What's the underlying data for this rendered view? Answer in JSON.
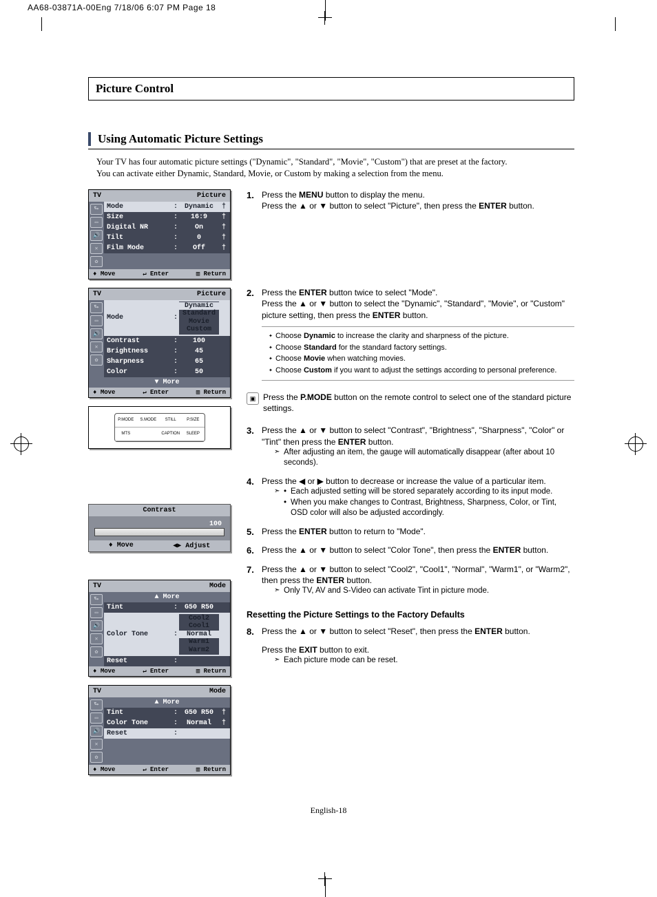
{
  "print_header": "AA68-03871A-00Eng  7/18/06  6:07 PM  Page 18",
  "section_title": "Picture Control",
  "subheading": "Using Automatic Picture Settings",
  "intro_line1": "Your TV has four automatic picture settings (\"Dynamic\", \"Standard\", \"Movie\", \"Custom\") that are preset at the factory.",
  "intro_line2": "You can activate either Dynamic, Standard, Movie, or Custom by making a selection from the menu.",
  "osd1": {
    "title_left": "TV",
    "title_right": "Picture",
    "rows": [
      {
        "label": "Mode",
        "value": "Dynamic",
        "hl": true,
        "arrow": "†"
      },
      {
        "label": "Size",
        "value": "16:9",
        "arrow": "†"
      },
      {
        "label": "Digital NR",
        "value": "On",
        "arrow": "†"
      },
      {
        "label": "Tilt",
        "value": "0",
        "arrow": "†"
      },
      {
        "label": "Film Mode",
        "value": "Off",
        "arrow": "†"
      }
    ],
    "footer": {
      "move": "Move",
      "enter": "Enter",
      "return": "Return"
    }
  },
  "osd2": {
    "title_left": "TV",
    "title_right": "Picture",
    "mode_label": "Mode",
    "options": [
      "Dynamic",
      "Standard",
      "Movie",
      "Custom"
    ],
    "option_hl": "Dynamic",
    "rows": [
      {
        "label": "Contrast",
        "value": "100"
      },
      {
        "label": "Brightness",
        "value": "45"
      },
      {
        "label": "Sharpness",
        "value": "65"
      },
      {
        "label": "Color",
        "value": "50"
      }
    ],
    "more": "▼ More",
    "footer": {
      "move": "Move",
      "enter": "Enter",
      "return": "Return"
    }
  },
  "remote": {
    "btns": [
      "P.MODE",
      "S.MODE",
      "STILL",
      "P.SIZE",
      "MTS",
      "",
      "CAPTION",
      "SLEEP"
    ]
  },
  "contrast": {
    "title": "Contrast",
    "value": "100",
    "move": "Move",
    "adjust": "Adjust"
  },
  "osd3": {
    "title_left": "TV",
    "title_right": "Mode",
    "more_top": "▲ More",
    "rows": [
      {
        "label": "Tint",
        "value": "G50 R50"
      },
      {
        "label": "Color Tone",
        "value": ""
      },
      {
        "label": "Reset",
        "value": ""
      }
    ],
    "options": [
      "Cool2",
      "Cool1",
      "Normal",
      "Warm1",
      "Warm2"
    ],
    "option_hl": "Normal",
    "footer": {
      "move": "Move",
      "enter": "Enter",
      "return": "Return"
    }
  },
  "osd4": {
    "title_left": "TV",
    "title_right": "Mode",
    "more_top": "▲ More",
    "rows": [
      {
        "label": "Tint",
        "value": "G50 R50",
        "arrow": "†"
      },
      {
        "label": "Color Tone",
        "value": "Normal",
        "arrow": "†"
      },
      {
        "label": "Reset",
        "value": "",
        "hl": true
      }
    ],
    "footer": {
      "move": "Move",
      "enter": "Enter",
      "return": "Return"
    }
  },
  "steps": {
    "s1a": "Press the ",
    "s1a_b": "MENU",
    "s1a2": " button to display the menu.",
    "s1b": "Press the ▲ or ▼ button to select \"Picture\", then press the ",
    "s1b_b": "ENTER",
    "s1b2": " button.",
    "s2a": "Press the ",
    "s2a_b": "ENTER",
    "s2a2": " button twice to select \"Mode\".",
    "s2b": "Press the ▲ or ▼ button to select the \"Dynamic\", \"Standard\", \"Movie\", or \"Custom\" picture setting, then press the ",
    "s2b_b": "ENTER",
    "s2b2": " button.",
    "s2_bullets": [
      {
        "pre": "Choose ",
        "b": "Dynamic",
        "post": " to increase the clarity and sharpness of the picture."
      },
      {
        "pre": "Choose ",
        "b": "Standard",
        "post": " for the standard factory settings."
      },
      {
        "pre": "Choose ",
        "b": "Movie",
        "post": " when watching movies."
      },
      {
        "pre": "Choose ",
        "b": "Custom",
        "post": " if you want to adjust the settings according to personal preference."
      }
    ],
    "pmode_a": "Press the ",
    "pmode_b": "P.MODE",
    "pmode_c": " button on the remote control to select one of the standard picture settings.",
    "s3a": "Press the ▲ or ▼ button to select \"Contrast\", \"Brightness\", \"Sharpness\", \"Color\" or \"Tint\" then press the ",
    "s3a_b": "ENTER",
    "s3a2": " button.",
    "s3_note": "After adjusting an item, the gauge will automatically disappear (after about 10 seconds).",
    "s4": "Press the ◀ or ▶ button to decrease or increase the value of a particular item.",
    "s4_b1": "Each adjusted setting will be stored separately according to its input mode.",
    "s4_b2": "When you make changes to Contrast, Brightness, Sharpness, Color, or Tint, OSD color will also be adjusted accordingly.",
    "s5a": "Press the ",
    "s5a_b": "ENTER",
    "s5a2": " button to return to \"Mode\".",
    "s6a": "Press the ▲ or ▼ button to select \"Color Tone\", then press the ",
    "s6a_b": "ENTER",
    "s6a2": " button.",
    "s7a": "Press the ▲ or ▼ button to select \"Cool2\", \"Cool1\", \"Normal\", \"Warm1\", or \"Warm2\", then press the ",
    "s7a_b": "ENTER",
    "s7a2": " button.",
    "s7_note": "Only TV, AV and S-Video can activate Tint in picture mode.",
    "reset_title": "Resetting the Picture Settings to the Factory Defaults",
    "s8a": "Press the ▲ or ▼ button to select \"Reset\", then press the ",
    "s8a_b": "ENTER",
    "s8a2": " button.",
    "s8_exit_a": "Press the ",
    "s8_exit_b": "EXIT",
    "s8_exit_c": " button to exit.",
    "s8_note": "Each picture mode can be reset."
  },
  "page_footer": "English-18"
}
